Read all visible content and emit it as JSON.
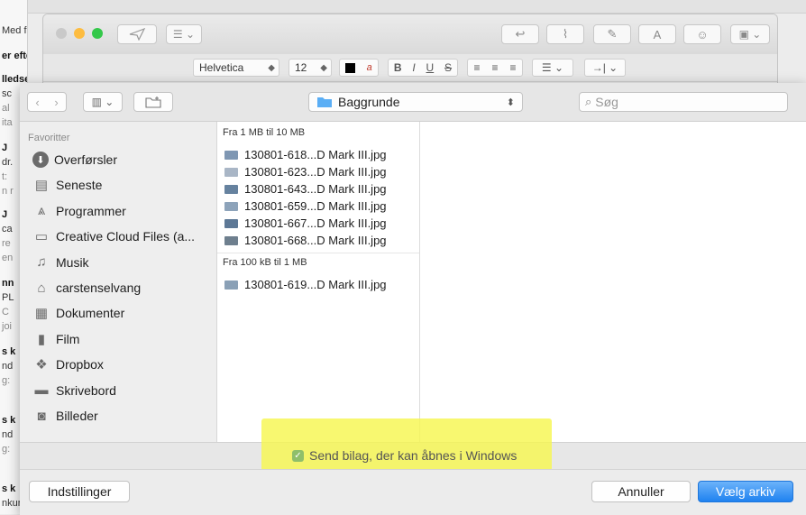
{
  "background_list": {
    "snippets": [
      {
        "text": "Med f",
        "style": "n"
      },
      {
        "text": "er efter",
        "style": "b"
      },
      {
        "text": "lledsel",
        "style": "b"
      },
      {
        "text": "sc",
        "style": "n"
      },
      {
        "text": "al",
        "style": "g"
      },
      {
        "text": "ita",
        "style": "g"
      },
      {
        "text": "J",
        "style": "b"
      },
      {
        "text": "dr.",
        "style": "n"
      },
      {
        "text": "t:",
        "style": "g"
      },
      {
        "text": "n r",
        "style": "g"
      },
      {
        "text": "J",
        "style": "b"
      },
      {
        "text": "ca",
        "style": "n"
      },
      {
        "text": "re",
        "style": "g"
      },
      {
        "text": "en",
        "style": "g"
      },
      {
        "text": "nn",
        "style": "b"
      },
      {
        "text": "PL",
        "style": "n"
      },
      {
        "text": "C",
        "style": "g"
      },
      {
        "text": "joi",
        "style": "g"
      },
      {
        "text": "s k",
        "style": "b"
      },
      {
        "text": "nd",
        "style": "n"
      },
      {
        "text": "g:",
        "style": "g"
      },
      {
        "text": "s k",
        "style": "b"
      },
      {
        "text": "nd",
        "style": "n"
      },
      {
        "text": "g:",
        "style": "g"
      },
      {
        "text": "s k",
        "style": "b"
      },
      {
        "text": "nkurren",
        "style": "n"
      }
    ]
  },
  "compose": {
    "font_name": "Helvetica",
    "font_size": "12",
    "format_buttons": [
      "B",
      "I",
      "U",
      "S"
    ]
  },
  "dialog": {
    "location": "Baggrunde",
    "search_placeholder": "Søg",
    "sidebar": {
      "header": "Favoritter",
      "items": [
        {
          "label": "Overførsler",
          "icon": "download-icon"
        },
        {
          "label": "Seneste",
          "icon": "recents-icon"
        },
        {
          "label": "Programmer",
          "icon": "applications-icon"
        },
        {
          "label": "Creative Cloud Files (a...",
          "icon": "folder-icon"
        },
        {
          "label": "Musik",
          "icon": "music-icon"
        },
        {
          "label": "carstenselvang",
          "icon": "home-icon"
        },
        {
          "label": "Dokumenter",
          "icon": "documents-icon"
        },
        {
          "label": "Film",
          "icon": "film-icon"
        },
        {
          "label": "Dropbox",
          "icon": "dropbox-icon"
        },
        {
          "label": "Skrivebord",
          "icon": "desktop-icon"
        },
        {
          "label": "Billeder",
          "icon": "pictures-icon"
        }
      ]
    },
    "groups": [
      {
        "title": "Fra 1 MB til 10 MB",
        "files": [
          {
            "name": "130801-618...D Mark III.jpg"
          },
          {
            "name": "130801-623...D Mark III.jpg"
          },
          {
            "name": "130801-643...D Mark III.jpg"
          },
          {
            "name": "130801-659...D Mark III.jpg"
          },
          {
            "name": "130801-667...D Mark III.jpg"
          },
          {
            "name": "130801-668...D Mark III.jpg"
          }
        ]
      },
      {
        "title": "Fra 100 kB til 1 MB",
        "files": [
          {
            "name": "130801-619...D Mark III.jpg"
          }
        ]
      }
    ],
    "option_label": "Send bilag, der kan åbnes i Windows",
    "option_checked": true,
    "settings_button": "Indstillinger",
    "cancel_button": "Annuller",
    "choose_button": "Vælg arkiv"
  },
  "colors": {
    "accent": "#1f82f0",
    "highlight": "#f6f650",
    "traffic_red": "#fc605b",
    "traffic_yellow": "#fdbc40",
    "traffic_green": "#34c84a",
    "folder_blue": "#5aaef5"
  }
}
